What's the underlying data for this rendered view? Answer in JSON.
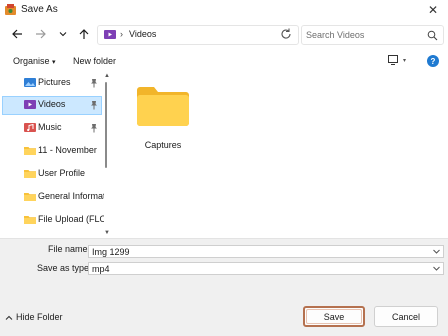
{
  "window": {
    "title": "Save As",
    "close_glyph": "✕"
  },
  "nav": {
    "back_icon": "arrow-left-icon",
    "forward_icon": "arrow-right-icon",
    "recent_icon": "chevron-down-icon",
    "up_icon": "arrow-up-icon",
    "address": {
      "separator": "›",
      "location": "Videos"
    },
    "refresh_icon": "refresh-icon",
    "search_placeholder": "Search Videos"
  },
  "toolbar": {
    "organise_label": "Organise",
    "organise_caret": "▾",
    "new_folder_label": "New folder",
    "help_label": "?"
  },
  "sidebar": {
    "items": [
      {
        "label": "Pictures",
        "icon": "pictures-icon",
        "pinned": true,
        "selected": false
      },
      {
        "label": "Videos",
        "icon": "videos-icon",
        "pinned": true,
        "selected": true
      },
      {
        "label": "Music",
        "icon": "music-icon",
        "pinned": true,
        "selected": false
      },
      {
        "label": "11 - November",
        "icon": "folder-icon",
        "pinned": false,
        "selected": false
      },
      {
        "label": "User Profile",
        "icon": "folder-icon",
        "pinned": false,
        "selected": false
      },
      {
        "label": "General Informat",
        "icon": "folder-icon",
        "pinned": false,
        "selected": false
      },
      {
        "label": "File Upload (FLO",
        "icon": "folder-icon",
        "pinned": false,
        "selected": false
      }
    ]
  },
  "content": {
    "items": [
      {
        "name": "Captures",
        "icon": "folder-icon"
      }
    ]
  },
  "fields": {
    "file_name_label": "File name:",
    "file_name_value": "Img 1299",
    "save_type_label": "Save as type:",
    "save_type_value": "mp4"
  },
  "footer": {
    "hide_folder_label": "Hide Folder",
    "save_label": "Save",
    "cancel_label": "Cancel"
  },
  "colors": {
    "selection_bg": "#cce8ff",
    "folder_yellow": "#f8c23a",
    "save_border": "#b5714f",
    "help_blue": "#1f7ad1"
  }
}
